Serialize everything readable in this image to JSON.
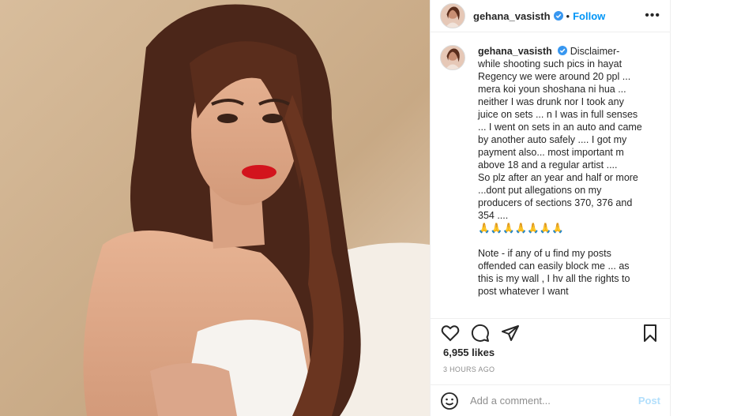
{
  "post": {
    "username": "gehana_vasisth",
    "follow_label": "Follow",
    "separator": "•",
    "more_label": "•••",
    "caption": "Disclaimer- while shooting such pics in hayat Regency we were around 20 ppl ... mera koi youn shoshana ni hua ... neither I was drunk nor I took any juice on sets ... n I was in full senses ... I went on sets in an auto and came by another auto safely .... I got my payment also... most important m above 18 and a regular artist ....\nSo plz after an year and half or more ...dont put allegations on my producers of sections 370, 376 and 354 ....\n🙏🙏🙏🙏🙏🙏🙏\n\nNote - if any of u find my posts offended can easily block me ... as this is my wall , I hv all the rights to post whatever I want",
    "likes": "6,955 likes",
    "time": "3 HOURS AGO"
  },
  "comment": {
    "placeholder": "Add a comment...",
    "post_label": "Post"
  },
  "icons": {
    "verified": "verified-badge-icon",
    "like": "heart-icon",
    "comment": "comment-icon",
    "share": "paper-plane-icon",
    "save": "bookmark-icon",
    "emoji": "smiley-icon"
  },
  "colors": {
    "accent": "#0095f6",
    "post_disabled": "#b2dffc",
    "muted": "#8e8e8e",
    "lips": "#d3141d"
  }
}
